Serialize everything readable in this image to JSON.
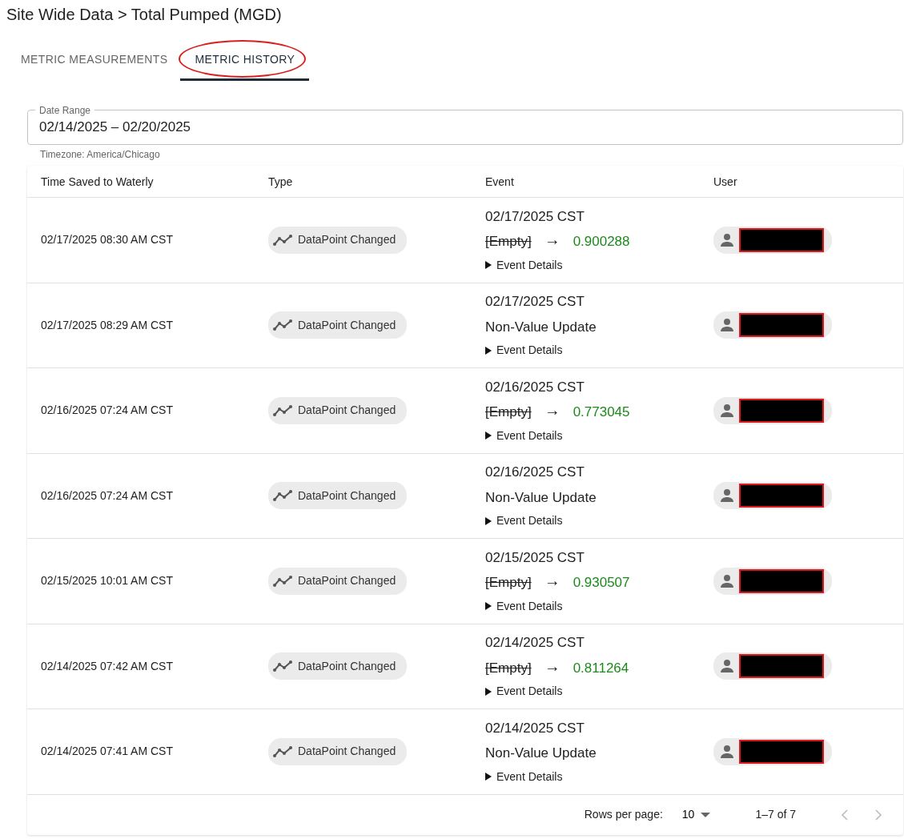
{
  "page_title": "Site Wide Data > Total Pumped (MGD)",
  "tabs": [
    {
      "label": "METRIC MEASUREMENTS",
      "selected": false,
      "circled": false
    },
    {
      "label": "METRIC HISTORY",
      "selected": true,
      "circled": true
    }
  ],
  "date_range": {
    "label": "Date Range",
    "value": "02/14/2025 – 02/20/2025",
    "helper": "Timezone: America/Chicago"
  },
  "table": {
    "columns": [
      "Time Saved to Waterly",
      "Type",
      "Event",
      "User"
    ],
    "rows": [
      {
        "time": "02/17/2025 08:30 AM CST",
        "type": "DataPoint Changed",
        "event": {
          "kind": "value_change",
          "date": "02/17/2025 CST",
          "old": "[Empty]",
          "arrow": "→",
          "new": "0.900288",
          "details": "Event Details"
        },
        "user_redacted": true
      },
      {
        "time": "02/17/2025 08:29 AM CST",
        "type": "DataPoint Changed",
        "event": {
          "kind": "non_value",
          "date": "02/17/2025 CST",
          "text": "Non-Value Update",
          "details": "Event Details"
        },
        "user_redacted": true
      },
      {
        "time": "02/16/2025 07:24 AM CST",
        "type": "DataPoint Changed",
        "event": {
          "kind": "value_change",
          "date": "02/16/2025 CST",
          "old": "[Empty]",
          "arrow": "→",
          "new": "0.773045",
          "details": "Event Details"
        },
        "user_redacted": true
      },
      {
        "time": "02/16/2025 07:24 AM CST",
        "type": "DataPoint Changed",
        "event": {
          "kind": "non_value",
          "date": "02/16/2025 CST",
          "text": "Non-Value Update",
          "details": "Event Details"
        },
        "user_redacted": true
      },
      {
        "time": "02/15/2025 10:01 AM CST",
        "type": "DataPoint Changed",
        "event": {
          "kind": "value_change",
          "date": "02/15/2025 CST",
          "old": "[Empty]",
          "arrow": "→",
          "new": "0.930507",
          "details": "Event Details"
        },
        "user_redacted": true
      },
      {
        "time": "02/14/2025 07:42 AM CST",
        "type": "DataPoint Changed",
        "event": {
          "kind": "value_change",
          "date": "02/14/2025 CST",
          "old": "[Empty]",
          "arrow": "→",
          "new": "0.811264",
          "details": "Event Details"
        },
        "user_redacted": true
      },
      {
        "time": "02/14/2025 07:41 AM CST",
        "type": "DataPoint Changed",
        "event": {
          "kind": "non_value",
          "date": "02/14/2025 CST",
          "text": "Non-Value Update",
          "details": "Event Details"
        },
        "user_redacted": true
      }
    ]
  },
  "pagination": {
    "rows_per_page_label": "Rows per page:",
    "rows_per_page": "10",
    "range": "1–7 of 7",
    "prev_disabled": true,
    "next_disabled": true
  }
}
